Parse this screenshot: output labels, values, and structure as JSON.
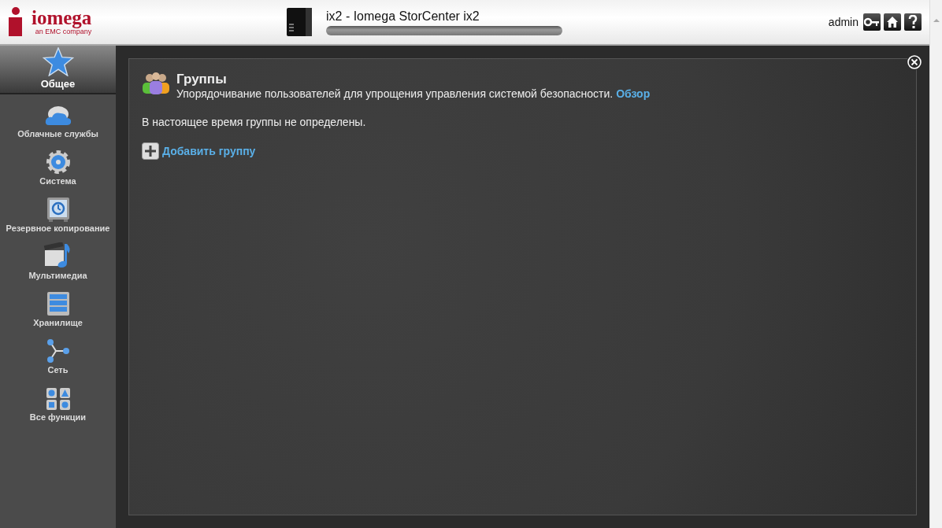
{
  "header": {
    "logo": {
      "name": "iomega",
      "tagline": "an EMC company"
    },
    "device_title": "ix2 - Iomega StorCenter ix2",
    "user": "admin"
  },
  "sidebar": {
    "items": [
      {
        "label": "Общее",
        "selected": true
      },
      {
        "label": "Облачные службы",
        "selected": false
      },
      {
        "label": "Система",
        "selected": false
      },
      {
        "label": "Резервное копирование",
        "selected": false
      },
      {
        "label": "Мультимедиа",
        "selected": false
      },
      {
        "label": "Хранилище",
        "selected": false
      },
      {
        "label": "Сеть",
        "selected": false
      },
      {
        "label": "Все функции",
        "selected": false
      }
    ]
  },
  "panel": {
    "title": "Группы",
    "description": "Упорядочивание пользователей для упрощения управления системой безопасности.",
    "overview_link": "Обзор",
    "message": "В настоящее время группы не определены.",
    "add_link": "Добавить группу"
  }
}
